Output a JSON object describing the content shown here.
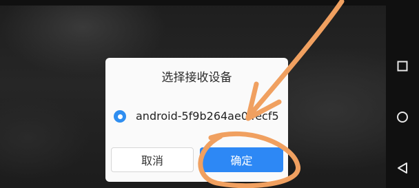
{
  "dialog": {
    "title": "选择接收设备",
    "devices": [
      {
        "label": "android-5f9b264ae04ecf5",
        "selected": true
      }
    ],
    "cancel_label": "取消",
    "confirm_label": "确定"
  },
  "navbar": {
    "recents_icon": "square-recents-icon",
    "home_icon": "circle-home-icon",
    "back_icon": "triangle-back-icon"
  },
  "annotation": {
    "color": "#f0a060",
    "shapes": [
      "arrow",
      "circle"
    ]
  },
  "colors": {
    "accent": "#2d88f5",
    "dialog_bg": "#fafafa"
  }
}
